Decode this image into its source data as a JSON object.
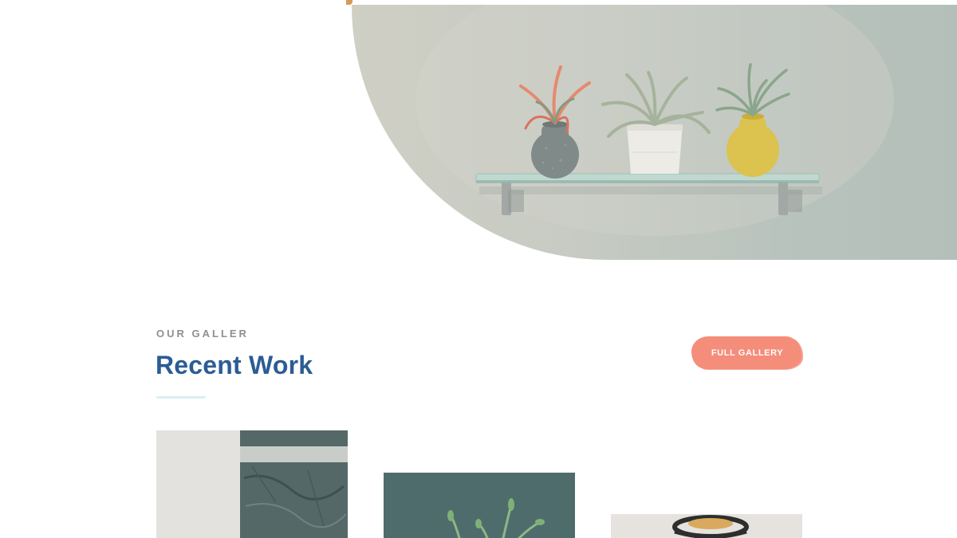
{
  "hero": {
    "image": "plants-on-glass-shelf"
  },
  "gallery_section": {
    "eyebrow": "OUR GALLER",
    "title": "Recent Work",
    "cta_label": "FULL GALLERY"
  },
  "gallery": {
    "items": [
      {
        "image": "textured-wall-art"
      },
      {
        "image": "green-plant-dark-wall"
      },
      {
        "image": "woven-pendant-lamp"
      }
    ]
  },
  "colors": {
    "accent": "#f48d7a",
    "title_blue": "#2b5c94",
    "hero_bg": "#c7cbc3"
  }
}
